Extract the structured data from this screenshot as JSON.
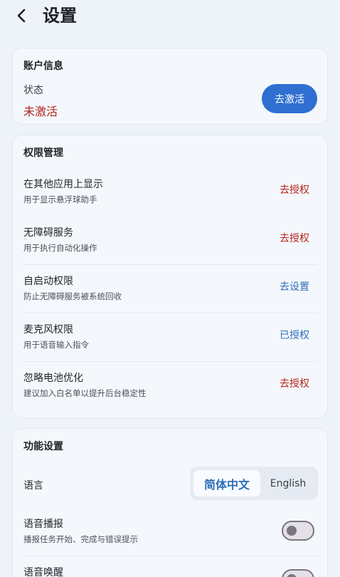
{
  "header": {
    "title": "设置"
  },
  "account": {
    "section_title": "账户信息",
    "status_label": "状态",
    "status_value": "未激活",
    "activate_label": "去激活",
    "status_color": "#b3261e",
    "button_color": "#2f6fd1"
  },
  "permissions": {
    "section_title": "权限管理",
    "items": [
      {
        "name": "在其他应用上显示",
        "desc": "用于显示悬浮球助手",
        "action": "去授权",
        "state": "pending"
      },
      {
        "name": "无障碍服务",
        "desc": "用于执行自动化操作",
        "action": "去授权",
        "state": "pending"
      },
      {
        "name": "自启动权限",
        "desc": "防止无障碍服务被系统回收",
        "action": "去设置",
        "state": "configure"
      },
      {
        "name": "麦克风权限",
        "desc": "用于语音输入指令",
        "action": "已授权",
        "state": "granted"
      },
      {
        "name": "忽略电池优化",
        "desc": "建议加入白名单以提升后台稳定性",
        "action": "去授权",
        "state": "pending"
      }
    ]
  },
  "functions": {
    "section_title": "功能设置",
    "language": {
      "label": "语言",
      "options": [
        "简体中文",
        "English"
      ],
      "selected": "简体中文"
    },
    "voice_broadcast": {
      "name": "语音播报",
      "desc": "播报任务开始、完成与错误提示",
      "enabled": false
    },
    "voice_wake": {
      "name": "语音唤醒",
      "enabled": false
    }
  }
}
